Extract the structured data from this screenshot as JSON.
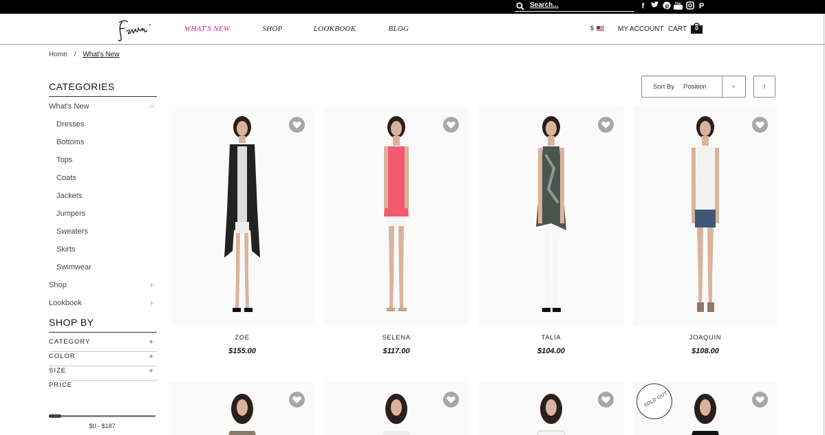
{
  "topbar": {
    "search_placeholder": "Search...",
    "social_icons": [
      "facebook-icon",
      "twitter-icon",
      "pinterest-icon",
      "youtube-icon",
      "instagram-icon",
      "polyvore-icon"
    ]
  },
  "header": {
    "logo_text": "Fevrie",
    "nav": [
      {
        "label": "WHAT'S NEW",
        "active": true
      },
      {
        "label": "SHOP"
      },
      {
        "label": "LOOKBOOK"
      },
      {
        "label": "BLOG"
      }
    ],
    "currency": "$",
    "my_account": "MY ACCOUNT",
    "cart": "CART",
    "cart_count": "0"
  },
  "breadcrumb": {
    "home": "Home",
    "separator": "/",
    "current": "What's New"
  },
  "sidebar": {
    "categories_title": "CATEGORIES",
    "categories": [
      {
        "label": "What's New",
        "toggle": "−"
      },
      {
        "label": "Dresses"
      },
      {
        "label": "Bottoms"
      },
      {
        "label": "Tops"
      },
      {
        "label": "Coats"
      },
      {
        "label": "Jackets"
      },
      {
        "label": "Jumpers"
      },
      {
        "label": "Sweaters"
      },
      {
        "label": "Skirts"
      },
      {
        "label": "Swimwear"
      },
      {
        "label": "Shop",
        "toggle": "+"
      },
      {
        "label": "Lookbook",
        "toggle": "+"
      }
    ],
    "shopby_title": "SHOP BY",
    "filters": [
      {
        "label": "CATEGORY",
        "toggle": "+"
      },
      {
        "label": "COLOR",
        "toggle": "+"
      },
      {
        "label": "SIZE",
        "toggle": "+"
      },
      {
        "label": "PRICE"
      }
    ],
    "price_range": "$0  -  $187"
  },
  "sort": {
    "label": "Sort By",
    "value": "Position",
    "chevron": "⌄",
    "direction": "↑"
  },
  "products": [
    {
      "name": "ZOE",
      "price": "$155.00"
    },
    {
      "name": "SELENA",
      "price": "$117.00"
    },
    {
      "name": "TALIA",
      "price": "$104.00"
    },
    {
      "name": "JOAQUIN",
      "price": "$108.00"
    }
  ],
  "row2": {
    "sold_out": "SOLD OUT"
  },
  "colors": {
    "accent": "#d0197c",
    "heart": "#a7a7a7"
  }
}
